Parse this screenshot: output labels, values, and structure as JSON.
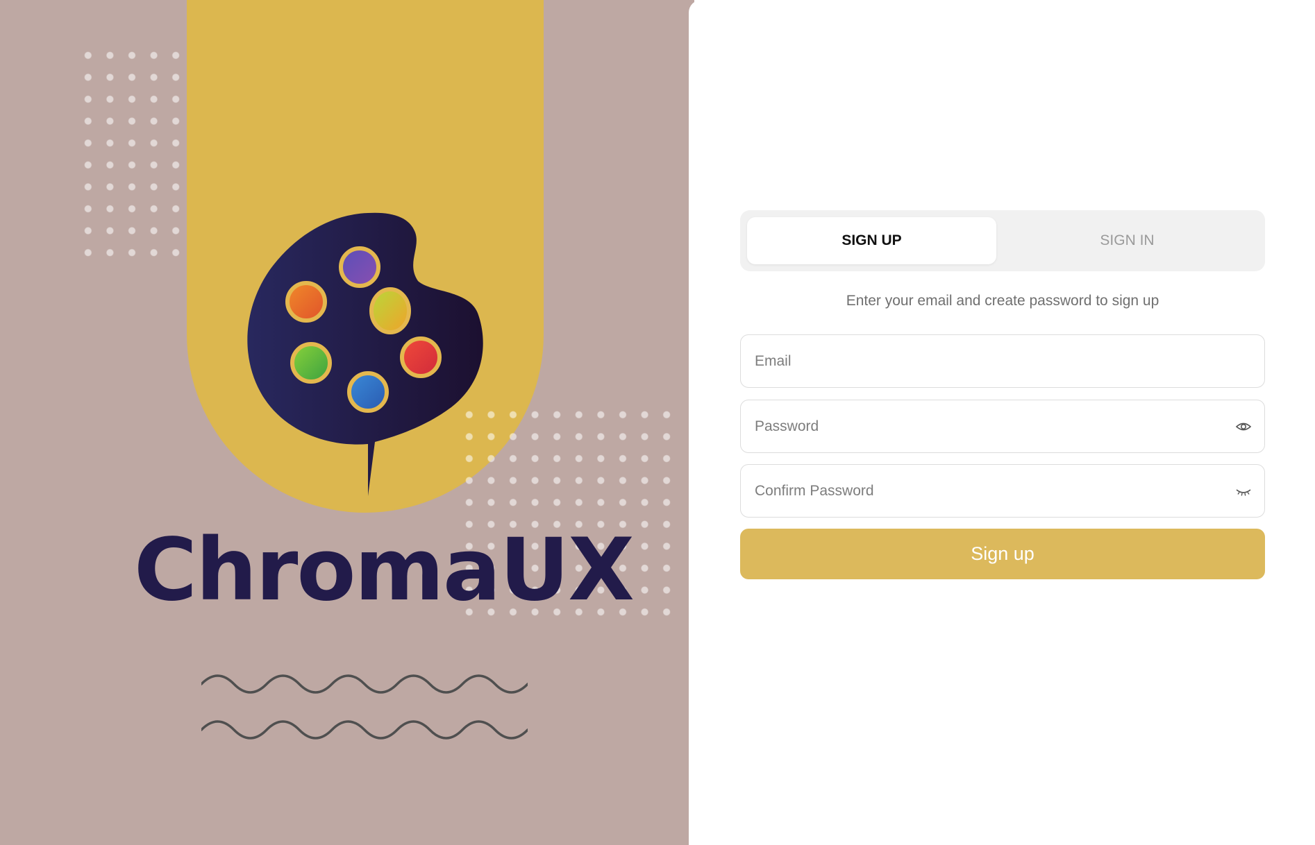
{
  "brand": {
    "name": "ChromaUX",
    "icon": "palette-icon",
    "colors": {
      "background": "#bea8a3",
      "arch": "#dcb74f",
      "palette_body": "#221b4a",
      "text": "#221b4a"
    }
  },
  "auth": {
    "tabs": [
      {
        "label": "SIGN UP",
        "active": true
      },
      {
        "label": "SIGN IN",
        "active": false
      }
    ],
    "subtitle": "Enter your email and create password to sign up",
    "fields": {
      "email": {
        "placeholder": "Email",
        "value": ""
      },
      "password": {
        "placeholder": "Password",
        "value": "",
        "icon": "eye-icon"
      },
      "confirm_password": {
        "placeholder": "Confirm Password",
        "value": "",
        "icon": "eye-closed-icon"
      }
    },
    "submit_label": "Sign up",
    "accent_color": "#dcb95c"
  }
}
